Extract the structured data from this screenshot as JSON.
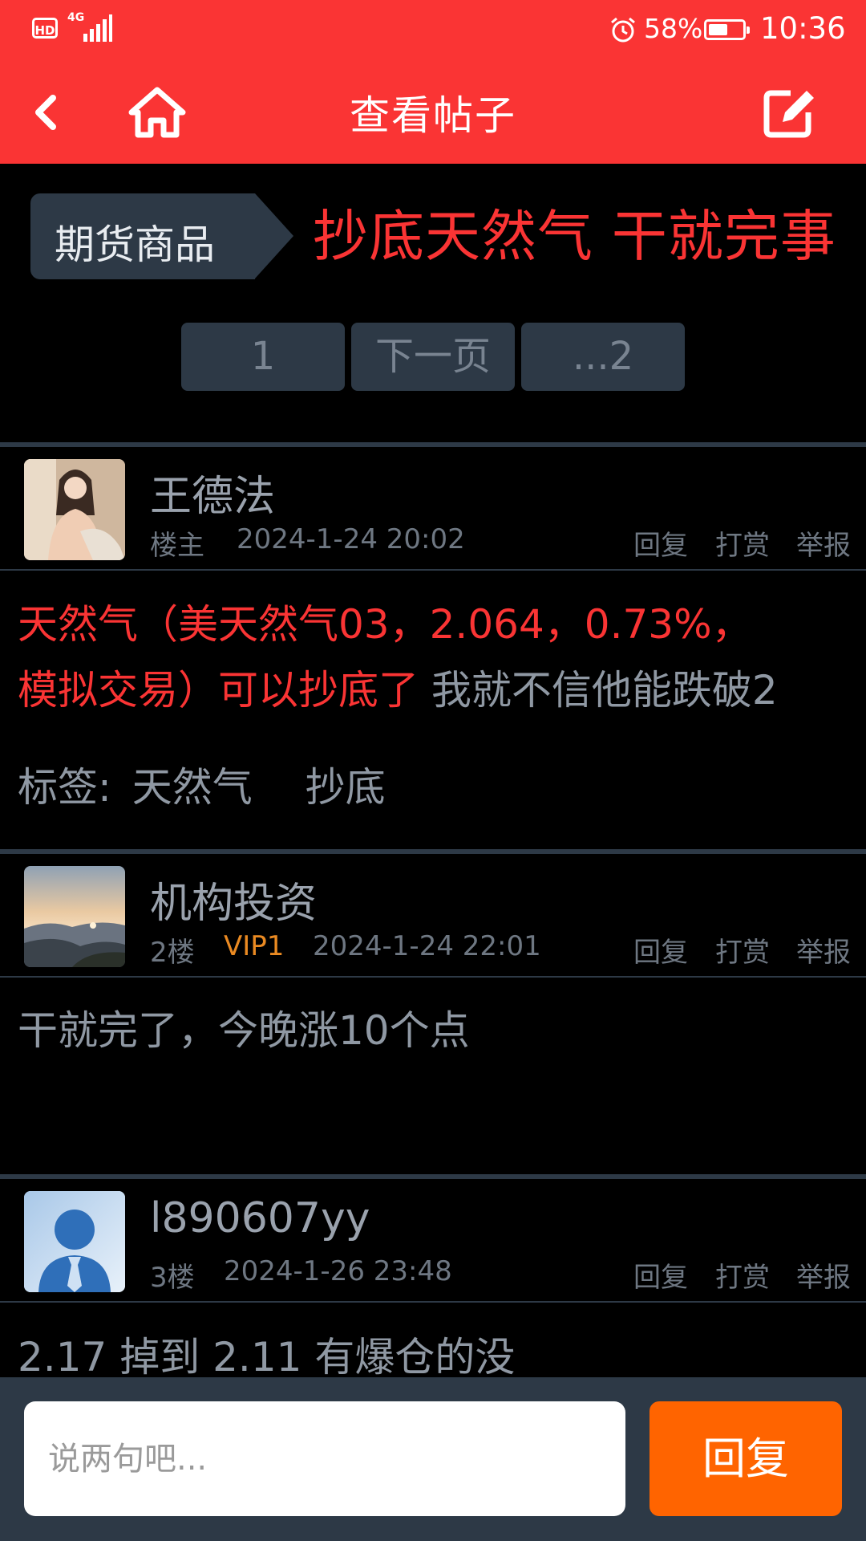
{
  "status_bar": {
    "hd_label": "HD",
    "network": "4G",
    "battery_percent": "58%",
    "battery_level": 0.58,
    "time": "10:36"
  },
  "nav": {
    "back_icon": "chevron-left",
    "home_icon": "home",
    "title": "查看帖子",
    "compose_icon": "edit"
  },
  "thread": {
    "category": "期货商品",
    "title": "抄底天然气 干就完事"
  },
  "pagination": {
    "page1": "1",
    "next": "下一页",
    "last": "...2"
  },
  "posts": [
    {
      "author": "王德法",
      "role": "楼主",
      "time": "2024-1-24 20:02",
      "avatar": "user-photo"
    },
    {
      "author": "机构投资",
      "role": "2楼",
      "vip": "VIP1",
      "time": "2024-1-24 22:01",
      "avatar": "landscape-photo",
      "content": "干就完了，今晚涨10个点"
    },
    {
      "author": "l890607yy",
      "role": "3楼",
      "time": "2024-1-26 23:48",
      "avatar": "default-user-icon",
      "content": "2.17 掉到 2.11 有爆仓的没"
    }
  ],
  "op_content": {
    "red_part_1": "天然气（美天然气03，2.064，0.73%，",
    "red_part_2": "模拟交易）可以抄底了",
    "normal_part": " 我就不信他能跌破2",
    "tags_label": "标签:",
    "tags": [
      "天然气",
      "抄底"
    ]
  },
  "actions": {
    "reply": "回复",
    "reward": "打赏",
    "report": "举报"
  },
  "composer": {
    "placeholder": "说两句吧...",
    "button": "回复"
  },
  "colors": {
    "header_red": "#fa3434",
    "accent_orange": "#ff6400",
    "panel": "#2d3946",
    "vip": "#ea8a22"
  }
}
